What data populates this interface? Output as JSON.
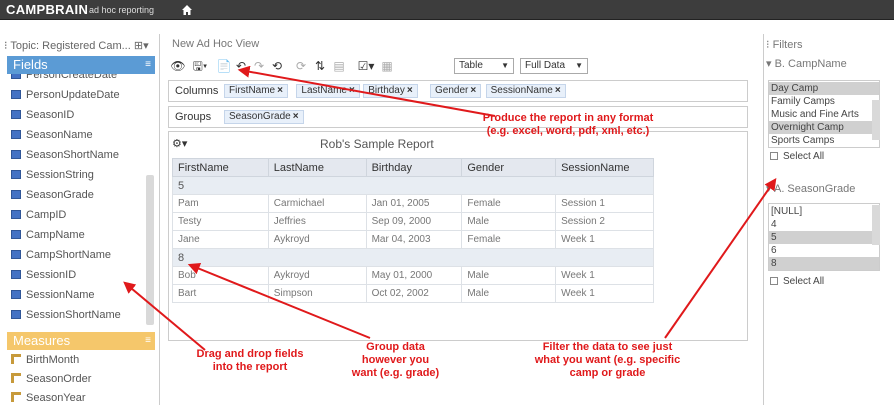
{
  "app": {
    "brand": "CAMPBRAIN",
    "brand_sub": "ad hoc reporting"
  },
  "left": {
    "topic": "Topic: Registered Cam...",
    "fields_header": "Fields",
    "fields": [
      "PersonCreateDate",
      "PersonUpdateDate",
      "SeasonID",
      "SeasonName",
      "SeasonShortName",
      "SessionString",
      "SeasonGrade",
      "CampID",
      "CampName",
      "CampShortName",
      "SessionID",
      "SessionName",
      "SessionShortName"
    ],
    "measures_header": "Measures",
    "measures": [
      "BirthMonth",
      "SeasonOrder",
      "SeasonYear"
    ]
  },
  "center": {
    "view_title": "New Ad Hoc View",
    "toolbar": {
      "view_type": "Table",
      "data_mode": "Full Data"
    },
    "columns_label": "Columns",
    "columns": [
      "FirstName",
      "LastName",
      "Birthday",
      "Gender",
      "SessionName"
    ],
    "groups_label": "Groups",
    "groups": [
      "SeasonGrade"
    ],
    "report_title": "Rob's Sample Report",
    "table": {
      "headers": [
        "FirstName",
        "LastName",
        "Birthday",
        "Gender",
        "SessionName"
      ],
      "groups": [
        {
          "label": "5",
          "rows": [
            [
              "Pam",
              "Carmichael",
              "Jan 01, 2005",
              "Female",
              "Session 1"
            ],
            [
              "Testy",
              "Jeffries",
              "Sep 09, 2000",
              "Male",
              "Session 2"
            ],
            [
              "Jane",
              "Aykroyd",
              "Mar 04, 2003",
              "Female",
              "Week 1"
            ]
          ]
        },
        {
          "label": "8",
          "rows": [
            [
              "Bob",
              "Aykroyd",
              "May 01, 2000",
              "Male",
              "Week 1"
            ],
            [
              "Bart",
              "Simpson",
              "Oct 02, 2002",
              "Male",
              "Week 1"
            ]
          ]
        }
      ]
    }
  },
  "right": {
    "title": "Filters",
    "filter_a": {
      "title": "B. CampName",
      "options": [
        "Day Camp",
        "Family Camps",
        "Music and Fine Arts",
        "Overnight Camp",
        "Sports Camps"
      ],
      "select_all": "Select All"
    },
    "filter_b": {
      "title": "A. SeasonGrade",
      "options": [
        "[NULL]",
        "4",
        "5",
        "6",
        "8"
      ],
      "select_all": "Select All"
    }
  },
  "annotations": {
    "produce": "Produce the report in any format (e.g. excel, word, pdf, xml, etc.)",
    "drag": "Drag and drop fields into the report",
    "group": "Group data however you want (e.g. grade)",
    "filter": "Filter the data to see just what you want (e.g. specific camp or grade"
  },
  "colors": {
    "fields_header": "#5b9bd5",
    "measures_header": "#f5c76b",
    "annotation": "#e0191b",
    "topbar": "#3d3d3d"
  }
}
